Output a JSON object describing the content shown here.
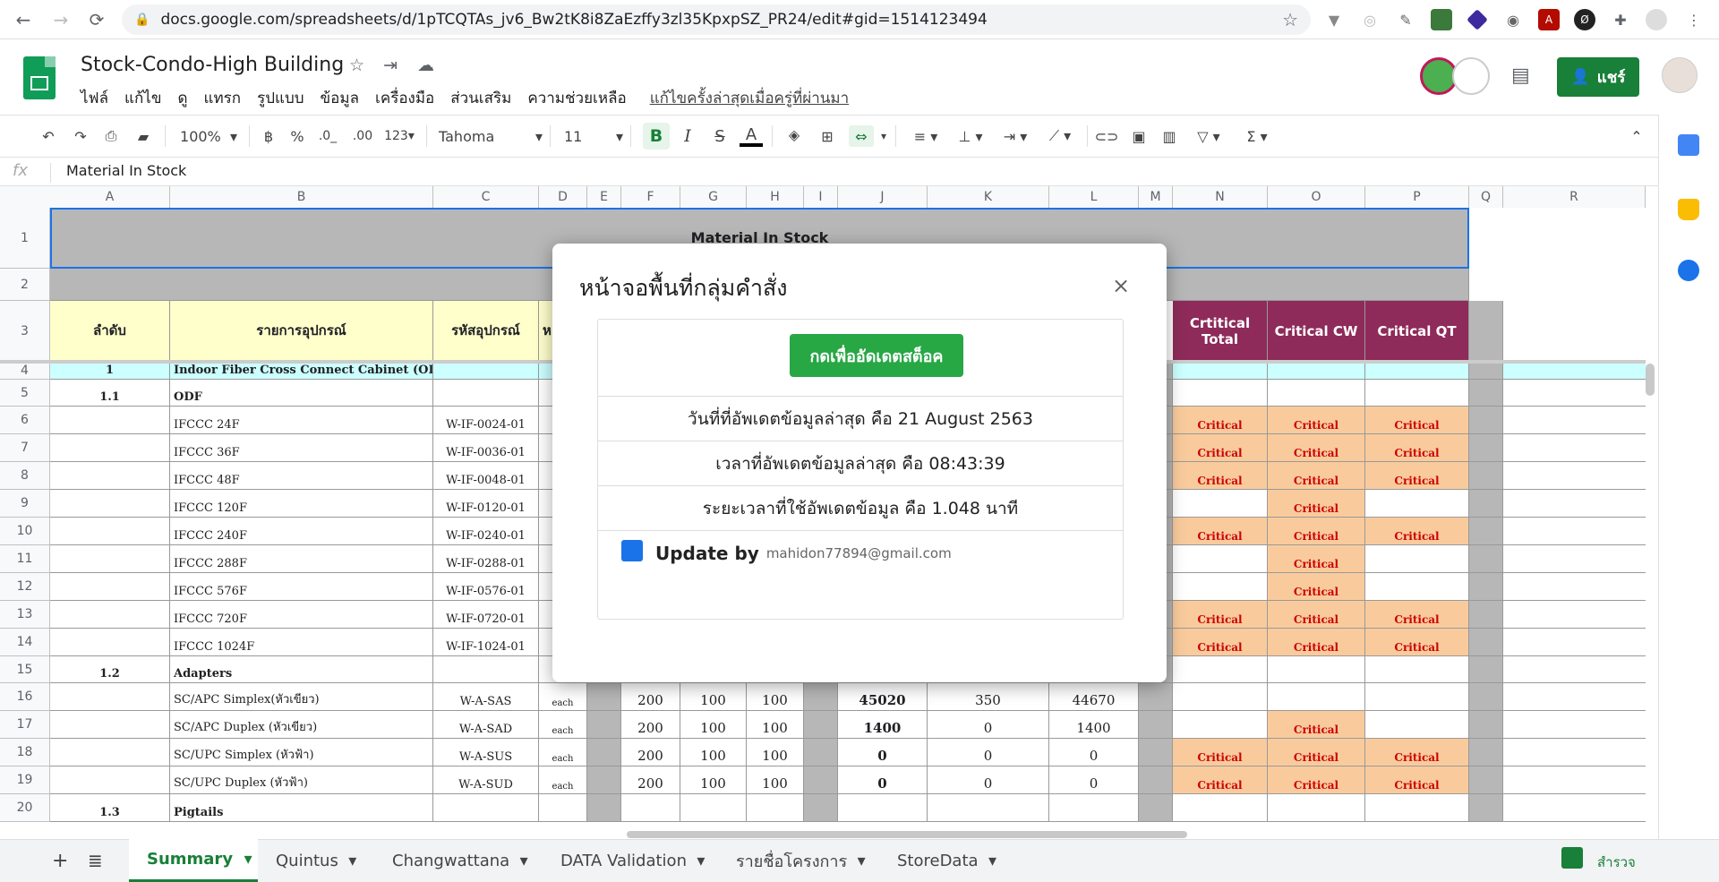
{
  "browser": {
    "url": "docs.google.com/spreadsheets/d/1pTCQTAs_jv6_Bw2tK8i8ZaEzffy3zl35KpxpSZ_PR24/edit#gid=1514123494"
  },
  "app": {
    "title": "Stock-Condo-High Building",
    "menu": [
      "ไฟล์",
      "แก้ไข",
      "ดู",
      "แทรก",
      "รูปแบบ",
      "ข้อมูล",
      "เครื่องมือ",
      "ส่วนเสริม",
      "ความช่วยเหลือ"
    ],
    "last_edit": "แก้ไขครั้งล่าสุดเมื่อครู่ที่ผ่านมา",
    "share_label": "แชร์"
  },
  "toolbar": {
    "zoom": "100%",
    "currency": "฿",
    "percent": "%",
    "dec_less": ".0_",
    "dec_more": ".00",
    "format": "123",
    "font": "Tahoma",
    "font_size": "11",
    "bold": "B",
    "italic": "I",
    "strike": "S",
    "text_color": "A"
  },
  "formula_bar": {
    "fx": "fx",
    "value": "Material In Stock"
  },
  "columns": [
    "A",
    "B",
    "C",
    "D",
    "E",
    "F",
    "G",
    "H",
    "I",
    "J",
    "K",
    "L",
    "M",
    "N",
    "O",
    "P",
    "Q",
    "R"
  ],
  "rows": [
    "1",
    "2",
    "3",
    "4",
    "5",
    "6",
    "7",
    "8",
    "9",
    "10",
    "11",
    "12",
    "13",
    "14",
    "15",
    "16",
    "17",
    "18",
    "19",
    "20"
  ],
  "sheet": {
    "title_cell": "Material In Stock",
    "headers": {
      "seq": "ลำดับ",
      "item": "รายการอุปกรณ์",
      "code": "รหัสอุปกรณ์",
      "unit_partial": "ห",
      "crit_total": "Crtitical Total",
      "crit_cw": "Critical CW",
      "crit_qt": "Critical QT"
    },
    "items": [
      {
        "seq": "1",
        "name": "Indoor Fiber Cross Connect Cabinet (ODF)",
        "code": "",
        "unit": "",
        "f": "",
        "g": "",
        "h": "",
        "j": "",
        "k": "",
        "l": "",
        "n": "",
        "o": "",
        "p": ""
      },
      {
        "seq": "1.1",
        "name": "ODF",
        "code": "",
        "unit": "",
        "f": "",
        "g": "",
        "h": "",
        "j": "",
        "k": "",
        "l": "",
        "n": "",
        "o": "",
        "p": ""
      },
      {
        "seq": "",
        "name": "IFCCC 24F",
        "code": "W-IF-0024-01",
        "unit": "",
        "f": "",
        "g": "",
        "h": "",
        "j": "",
        "k": "",
        "l": "",
        "n": "Critical",
        "o": "Critical",
        "p": "Critical"
      },
      {
        "seq": "",
        "name": "IFCCC 36F",
        "code": "W-IF-0036-01",
        "unit": "",
        "f": "",
        "g": "",
        "h": "",
        "j": "",
        "k": "",
        "l": "",
        "n": "Critical",
        "o": "Critical",
        "p": "Critical"
      },
      {
        "seq": "",
        "name": "IFCCC 48F",
        "code": "W-IF-0048-01",
        "unit": "",
        "f": "",
        "g": "",
        "h": "",
        "j": "",
        "k": "",
        "l": "",
        "n": "Critical",
        "o": "Critical",
        "p": "Critical"
      },
      {
        "seq": "",
        "name": "IFCCC 120F",
        "code": "W-IF-0120-01",
        "unit": "",
        "f": "",
        "g": "",
        "h": "",
        "j": "",
        "k": "",
        "l": "",
        "n": "",
        "o": "Critical",
        "p": ""
      },
      {
        "seq": "",
        "name": "IFCCC 240F",
        "code": "W-IF-0240-01",
        "unit": "",
        "f": "",
        "g": "",
        "h": "",
        "j": "",
        "k": "",
        "l": "",
        "n": "Critical",
        "o": "Critical",
        "p": "Critical"
      },
      {
        "seq": "",
        "name": "IFCCC 288F",
        "code": "W-IF-0288-01",
        "unit": "",
        "f": "",
        "g": "",
        "h": "",
        "j": "",
        "k": "",
        "l": "",
        "n": "",
        "o": "Critical",
        "p": ""
      },
      {
        "seq": "",
        "name": "IFCCC 576F",
        "code": "W-IF-0576-01",
        "unit": "",
        "f": "",
        "g": "",
        "h": "",
        "j": "",
        "k": "",
        "l": "",
        "n": "",
        "o": "Critical",
        "p": ""
      },
      {
        "seq": "",
        "name": "IFCCC 720F",
        "code": "W-IF-0720-01",
        "unit": "",
        "f": "",
        "g": "",
        "h": "",
        "j": "",
        "k": "",
        "l": "",
        "n": "Critical",
        "o": "Critical",
        "p": "Critical"
      },
      {
        "seq": "",
        "name": "IFCCC 1024F",
        "code": "W-IF-1024-01",
        "unit": "",
        "f": "",
        "g": "",
        "h": "",
        "j": "",
        "k": "",
        "l": "",
        "n": "Critical",
        "o": "Critical",
        "p": "Critical"
      },
      {
        "seq": "1.2",
        "name": "Adapters",
        "code": "",
        "unit": "",
        "f": "",
        "g": "",
        "h": "",
        "j": "",
        "k": "",
        "l": "",
        "n": "",
        "o": "",
        "p": ""
      },
      {
        "seq": "",
        "name": "SC/APC Simplex(หัวเขียว)",
        "code": "W-A-SAS",
        "unit": "each",
        "f": "200",
        "g": "100",
        "h": "100",
        "j": "45020",
        "k": "350",
        "l": "44670",
        "n": "",
        "o": "",
        "p": ""
      },
      {
        "seq": "",
        "name": "SC/APC Duplex (หัวเขียว)",
        "code": "W-A-SAD",
        "unit": "each",
        "f": "200",
        "g": "100",
        "h": "100",
        "j": "1400",
        "k": "0",
        "l": "1400",
        "n": "",
        "o": "Critical",
        "p": ""
      },
      {
        "seq": "",
        "name": "SC/UPC Simplex (หัวฟ้า)",
        "code": "W-A-SUS",
        "unit": "each",
        "f": "200",
        "g": "100",
        "h": "100",
        "j": "0",
        "k": "0",
        "l": "0",
        "n": "Critical",
        "o": "Critical",
        "p": "Critical"
      },
      {
        "seq": "",
        "name": "SC/UPC Duplex (หัวฟ้า)",
        "code": "W-A-SUD",
        "unit": "each",
        "f": "200",
        "g": "100",
        "h": "100",
        "j": "0",
        "k": "0",
        "l": "0",
        "n": "Critical",
        "o": "Critical",
        "p": "Critical"
      },
      {
        "seq": "1.3",
        "name": "Pigtails",
        "code": "",
        "unit": "",
        "f": "",
        "g": "",
        "h": "",
        "j": "",
        "k": "",
        "l": "",
        "n": "",
        "o": "",
        "p": ""
      }
    ]
  },
  "modal": {
    "title": "หน้าจอพื้นที่กลุ่มคำสั่ง",
    "close": "×",
    "button": "กดเพื่ออัดเดตสต็อค",
    "date_line": "วันที่ที่อัพเดตข้อมูลล่าสุด คือ 21 August 2563",
    "time_line": "เวลาที่อัพเดตข้อมูลล่าสุด คือ 08:43:39",
    "duration_line": "ระยะเวลาที่ใช้อัพเดตข้อมูล คือ 1.048 นาที",
    "update_by_label": "Update by",
    "update_by_email": "mahidon77894@gmail.com"
  },
  "tabs": [
    "Summary",
    "Quintus",
    "Changwattana",
    "DATA Validation",
    "รายชื่อโครงการ",
    "StoreData"
  ],
  "explore_label": "สำรวจ",
  "colors": {
    "accent": "#188038",
    "critical_bg": "#f9cb9c",
    "critical_text": "#cc0000",
    "header_maroon": "#8e2b5a"
  }
}
